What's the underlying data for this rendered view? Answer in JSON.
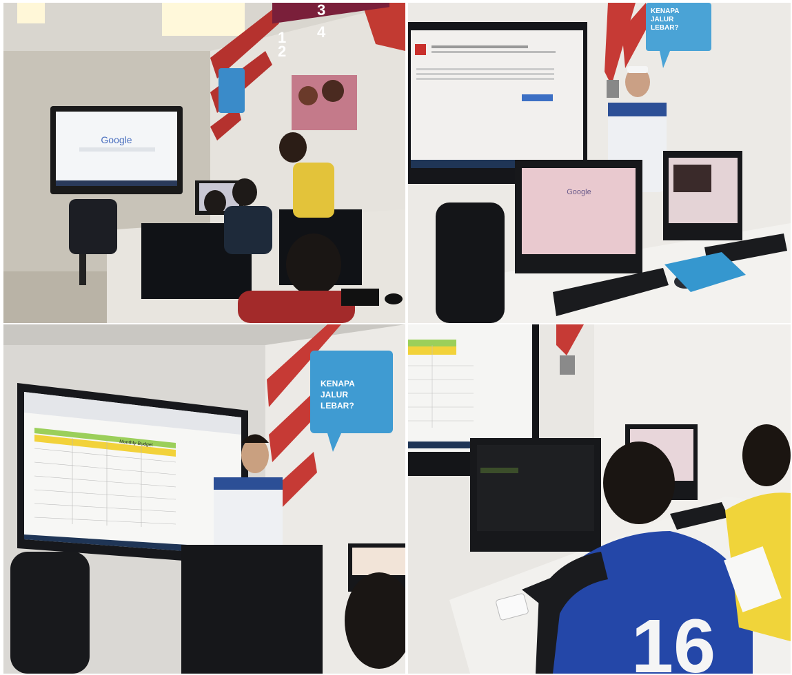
{
  "photos": [
    {
      "id": "top-left",
      "screen_word": "Google",
      "sign_numbers": [
        "1",
        "2",
        "3",
        "4"
      ]
    },
    {
      "id": "top-right",
      "screen_word": "Google",
      "bubble_lines": [
        "KENAPA",
        "JALUR",
        "LEBAR?"
      ]
    },
    {
      "id": "bottom-left",
      "spreadsheet_title": "Monthly Budget",
      "bubble_lines": [
        "KENAPA",
        "JALUR",
        "LEBAR?"
      ]
    },
    {
      "id": "bottom-right",
      "jersey_number": "16"
    }
  ]
}
